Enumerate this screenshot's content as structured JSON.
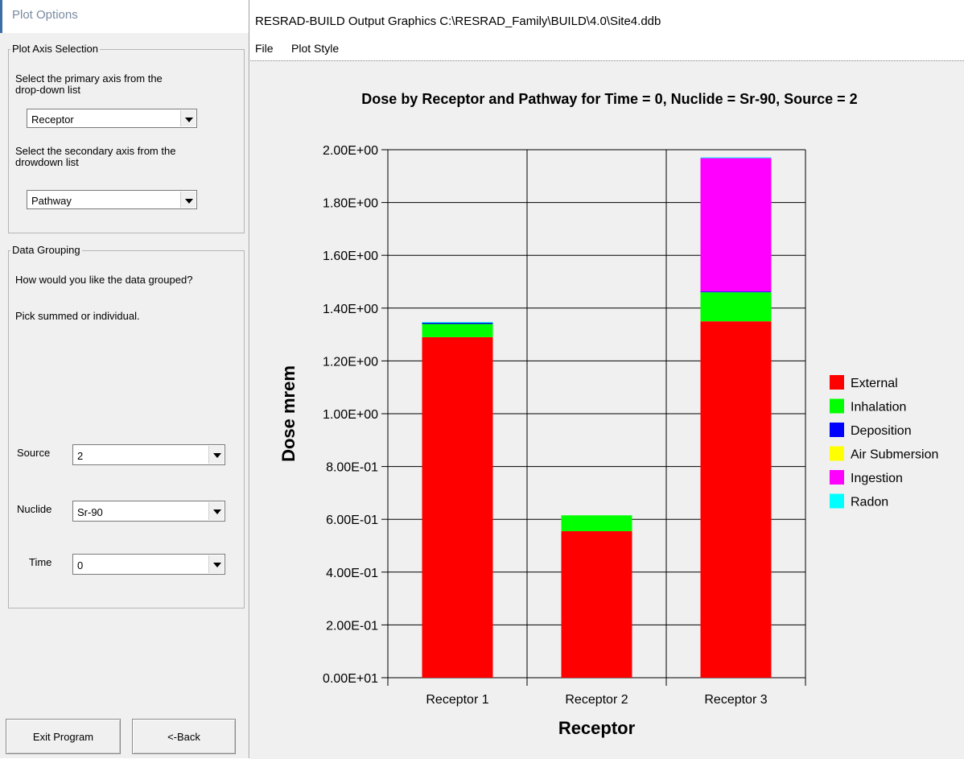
{
  "options_panel": {
    "title": "Plot Options",
    "axis_group": {
      "caption": "Plot Axis Selection",
      "primary_prompt_line1": "Select the primary axis from the",
      "primary_prompt_line2": "drop-down list",
      "primary_value": "Receptor",
      "secondary_prompt_line1": "Select the secondary axis from the",
      "secondary_prompt_line2": "drowdown list",
      "secondary_value": "Pathway"
    },
    "grouping": {
      "caption": "Data Grouping",
      "question": "How would you like the data grouped?",
      "hint": "Pick summed or individual.",
      "source_label": "Source",
      "source_value": "2",
      "nuclide_label": "Nuclide",
      "nuclide_value": "Sr-90",
      "time_label": "Time",
      "time_value": "0"
    },
    "exit_label": "Exit Program",
    "back_label": "<-Back"
  },
  "window": {
    "title": "RESRAD-BUILD Output Graphics C:\\RESRAD_Family\\BUILD\\4.0\\Site4.ddb",
    "menu": [
      "File",
      "Plot Style"
    ]
  },
  "colors": {
    "External": "#ff0000",
    "Inhalation": "#00ff00",
    "Deposition": "#0000ff",
    "Air Submersion": "#ffff00",
    "Ingestion": "#ff00ff",
    "Radon": "#00ffff"
  },
  "chart_data": {
    "type": "bar",
    "stacked": true,
    "title": "Dose by Receptor and Pathway for Time = 0, Nuclide = Sr-90, Source = 2",
    "xlabel": "Receptor",
    "ylabel": "Dose mrem",
    "categories": [
      "Receptor 1",
      "Receptor 2",
      "Receptor 3"
    ],
    "ylim": [
      0,
      2.0
    ],
    "yticks": [
      "0.00E+01",
      "2.00E-01",
      "4.00E-01",
      "6.00E-01",
      "8.00E-01",
      "1.00E+00",
      "1.20E+00",
      "1.40E+00",
      "1.60E+00",
      "1.80E+00",
      "2.00E+00"
    ],
    "grid": true,
    "legend_position": "right",
    "series": [
      {
        "name": "External",
        "values": [
          1.29,
          0.555,
          1.35
        ]
      },
      {
        "name": "Inhalation",
        "values": [
          0.05,
          0.06,
          0.11
        ]
      },
      {
        "name": "Deposition",
        "values": [
          0.005,
          0.0,
          0.003
        ]
      },
      {
        "name": "Air Submersion",
        "values": [
          0.0,
          0.0,
          0.0
        ]
      },
      {
        "name": "Ingestion",
        "values": [
          0.0,
          0.0,
          0.505
        ]
      },
      {
        "name": "Radon",
        "values": [
          0.002,
          0.0,
          0.003
        ]
      }
    ]
  }
}
